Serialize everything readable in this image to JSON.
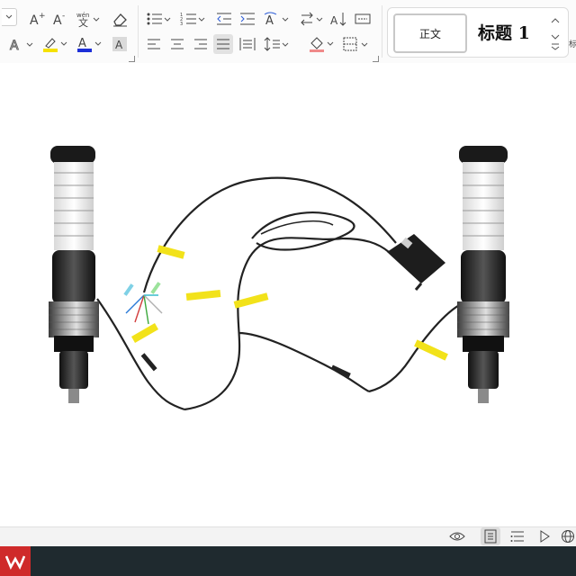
{
  "toolbar": {
    "row1": [
      "dropdown",
      "increase-font-size",
      "decrease-font-size",
      "phonetic-guide",
      "clear-format",
      "bullets",
      "numbering",
      "decrease-indent",
      "increase-indent",
      "chinese-layout",
      "text-direction",
      "sort",
      "show-hide"
    ],
    "row2": [
      "text-effect",
      "highlight",
      "font-color",
      "character-shading",
      "align-left",
      "align-center",
      "align-right",
      "justify",
      "distributed",
      "line-spacing",
      "shading",
      "borders"
    ],
    "highlight_color": "#f5e100",
    "font_color": "#1d2fd8",
    "accent_color": "#2a5bd7"
  },
  "styles": {
    "normal_label": "正文",
    "heading1_label": "标题 1",
    "next_label": "标"
  },
  "image": {
    "description_color_yellow_tag": "#f2e21a",
    "cable_color": "#222222"
  },
  "statusbar": {
    "icons": [
      "eye-icon",
      "page-view-icon",
      "outline-icon",
      "play-icon",
      "globe-icon"
    ]
  },
  "taskbar": {
    "app_color": "#cf2a2a"
  }
}
